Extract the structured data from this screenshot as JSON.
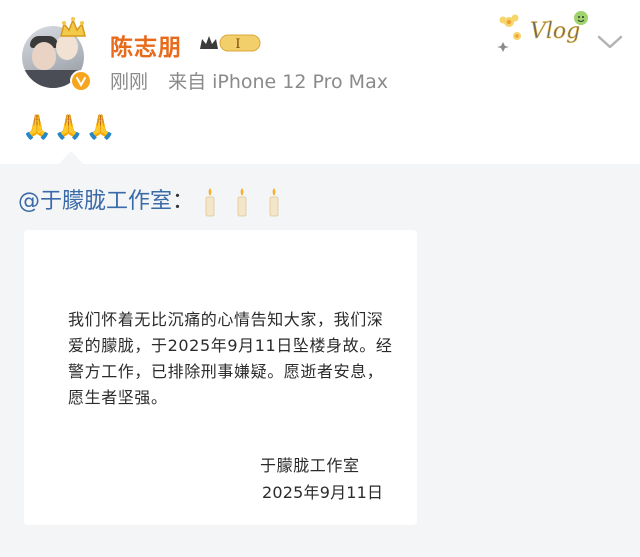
{
  "post": {
    "username": "陈志朋",
    "vip_level": "I",
    "time": "刚刚",
    "source": "来自 iPhone 12 Pro Max",
    "text": "🙏🙏🙏",
    "vlog_sticker": "Vlog",
    "colors": {
      "username": "#e86b1c",
      "badge": "#f7a51c",
      "mention": "#3a6aa8"
    }
  },
  "repost": {
    "mention": "@于朦胧工作室",
    "separator": "：",
    "statement": {
      "body": "我们怀着无比沉痛的心情告知大家，我们深爱的朦胧，于2025年9月11日坠楼身故。经警方工作，已排除刑事嫌疑。愿逝者安息，愿生者坚强。",
      "signature": "于朦胧工作室",
      "date": "2025年9月11日"
    }
  },
  "icons": [
    "avatar",
    "crown-icon",
    "verified-icon",
    "vip-crown-icon",
    "vlog-sticker",
    "chevron-down-icon",
    "candle-icon"
  ]
}
